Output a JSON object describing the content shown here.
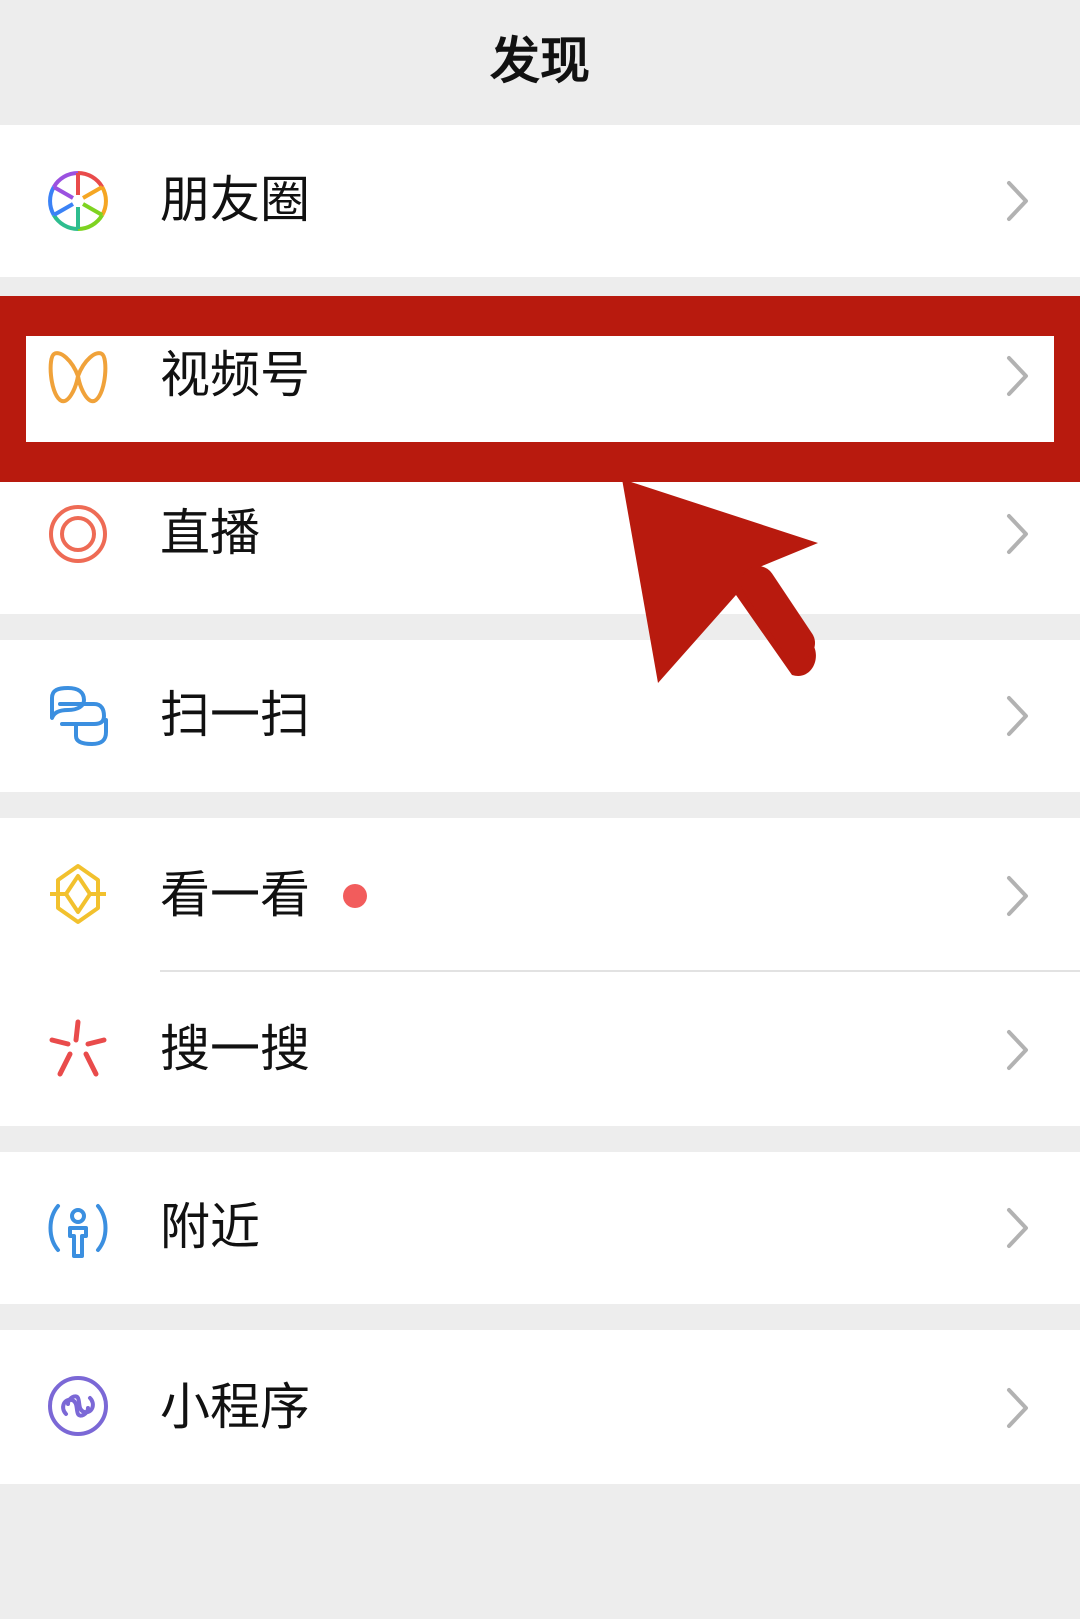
{
  "header": {
    "title": "发现"
  },
  "menu": [
    {
      "label": "朋友圈",
      "icon": "moments-aperture-icon"
    },
    {
      "label": "视频号",
      "icon": "channels-butterfly-icon"
    },
    {
      "label": "直播",
      "icon": "live-ring-icon"
    },
    {
      "label": "扫一扫",
      "icon": "scan-icon"
    },
    {
      "label": "看一看",
      "icon": "top-stories-icon",
      "badge": "red-dot"
    },
    {
      "label": "搜一搜",
      "icon": "search-sparkle-icon"
    },
    {
      "label": "附近",
      "icon": "nearby-person-icon"
    },
    {
      "label": "小程序",
      "icon": "mini-program-icon"
    }
  ],
  "chevron_icon": "chevron-right-icon",
  "annotation": {
    "highlight_target": "视频号",
    "shape": "box-and-arrow",
    "color": "#b81a0e"
  },
  "colors": {
    "background": "#ededed",
    "cell": "#ffffff",
    "badge": "#f25c5c",
    "chevron": "#b2b2b2"
  }
}
